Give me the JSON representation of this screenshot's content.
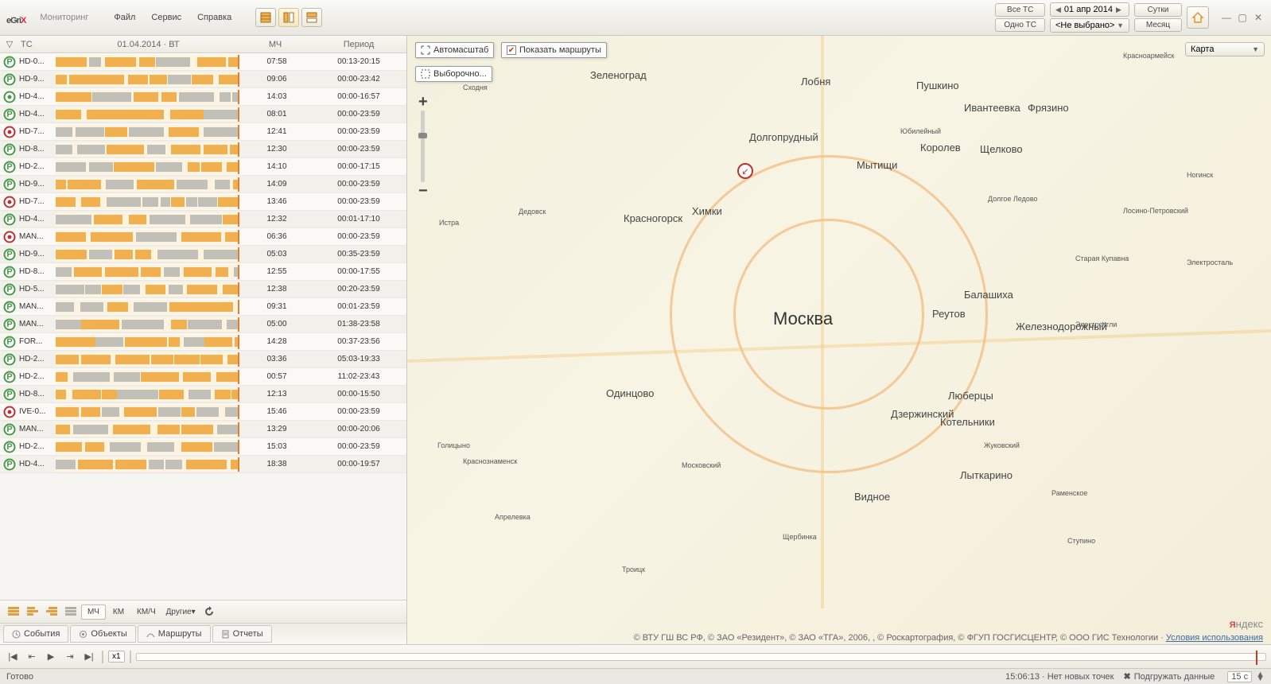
{
  "app": {
    "logo_main": "eGri",
    "logo_x": "X",
    "title": "Мониторинг",
    "menu": {
      "file": "Файл",
      "service": "Сервис",
      "help": "Справка"
    }
  },
  "date_nav": {
    "label": "01 апр 2014"
  },
  "right": {
    "all_ts": "Все ТС",
    "one_ts": "Одно ТС",
    "not_selected": "<Не выбрано>",
    "day": "Сутки",
    "month": "Месяц"
  },
  "columns": {
    "ts": "ТС",
    "date": "01.04.2014 · ВТ",
    "mch": "МЧ",
    "period": "Период"
  },
  "vehicles": [
    {
      "name": "HD-0...",
      "mch": "07:58",
      "period": "00:13-20:15",
      "st": "gp"
    },
    {
      "name": "HD-9...",
      "mch": "09:06",
      "period": "00:00-23:42",
      "st": "gp"
    },
    {
      "name": "HD-4...",
      "mch": "14:03",
      "period": "00:00-16:57",
      "st": "g"
    },
    {
      "name": "HD-4...",
      "mch": "08:01",
      "period": "00:00-23:59",
      "st": "gp"
    },
    {
      "name": "HD-7...",
      "mch": "12:41",
      "period": "00:00-23:59",
      "st": "r"
    },
    {
      "name": "HD-8...",
      "mch": "12:30",
      "period": "00:00-23:59",
      "st": "gp"
    },
    {
      "name": "HD-2...",
      "mch": "14:10",
      "period": "00:00-17:15",
      "st": "gp"
    },
    {
      "name": "HD-9...",
      "mch": "14:09",
      "period": "00:00-23:59",
      "st": "gp"
    },
    {
      "name": "HD-7...",
      "mch": "13:46",
      "period": "00:00-23:59",
      "st": "r"
    },
    {
      "name": "HD-4...",
      "mch": "12:32",
      "period": "00:01-17:10",
      "st": "gp"
    },
    {
      "name": "MAN...",
      "mch": "06:36",
      "period": "00:00-23:59",
      "st": "r"
    },
    {
      "name": "HD-9...",
      "mch": "05:03",
      "period": "00:35-23:59",
      "st": "gp"
    },
    {
      "name": "HD-8...",
      "mch": "12:55",
      "period": "00:00-17:55",
      "st": "gp"
    },
    {
      "name": "HD-5...",
      "mch": "12:38",
      "period": "00:20-23:59",
      "st": "gp"
    },
    {
      "name": "MAN...",
      "mch": "09:31",
      "period": "00:01-23:59",
      "st": "gp"
    },
    {
      "name": "MAN...",
      "mch": "05:00",
      "period": "01:38-23:58",
      "st": "gp"
    },
    {
      "name": "FOR...",
      "mch": "14:28",
      "period": "00:37-23:56",
      "st": "gp"
    },
    {
      "name": "HD-2...",
      "mch": "03:36",
      "period": "05:03-19:33",
      "st": "gp"
    },
    {
      "name": "HD-2...",
      "mch": "00:57",
      "period": "11:02-23:43",
      "st": "gp"
    },
    {
      "name": "HD-8...",
      "mch": "12:13",
      "period": "00:00-15:50",
      "st": "gp"
    },
    {
      "name": "IVE-0...",
      "mch": "15:46",
      "period": "00:00-23:59",
      "st": "r"
    },
    {
      "name": "MAN...",
      "mch": "13:29",
      "period": "00:00-20:06",
      "st": "gp"
    },
    {
      "name": "HD-2...",
      "mch": "15:03",
      "period": "00:00-23:59",
      "st": "gp"
    },
    {
      "name": "HD-4...",
      "mch": "18:38",
      "period": "00:00-19:57",
      "st": "gp"
    }
  ],
  "left_toolbar": {
    "mch": "МЧ",
    "km": "КМ",
    "kmh": "КМ/Ч",
    "other": "Другие▾"
  },
  "left_tabs": {
    "events": "События",
    "objects": "Объекты",
    "routes": "Маршруты",
    "reports": "Отчеты"
  },
  "map": {
    "autoscale": "Автомасштаб",
    "show_routes": "Показать маршруты",
    "selective": "Выборочно...",
    "type_label": "Карта",
    "moscow": "Москва",
    "cities_med": [
      "Зеленоград",
      "Химки",
      "Мытищи",
      "Королев",
      "Щелково",
      "Фрязино",
      "Пушкино",
      "Ивантеевка",
      "Долгопрудный",
      "Лобня",
      "Красногорск",
      "Балашиха",
      "Реутов",
      "Железнодорожный",
      "Одинцово",
      "Люберцы",
      "Дзержинский",
      "Котельники",
      "Лыткарино",
      "Видное",
      "Щербинка",
      "Московский",
      "Голицыно",
      "Краснознаменск",
      "Апрелевка",
      "Троицк",
      "Жуковский",
      "Раменское",
      "Электроугли",
      "Дедовск",
      "Старая Купавна",
      "Лосино-Петровский",
      "Электросталь",
      "Ногинск",
      "Красноармейск",
      "Сходня",
      "Истра",
      "Юбилейный",
      "Долгое Ледово",
      "Ступино"
    ],
    "attribution": "© ВТУ ГШ ВС РФ, © ЗАО «Резидент», © ЗАО «ТГА», 2006, , © Роскартография, © ФГУП ГОСГИСЦЕНТР, © ООО ГИС Технологии · ",
    "terms": "Условия использования",
    "ymaps_1": "Яндекс"
  },
  "timeline": {
    "speed": "x1"
  },
  "status": {
    "ready": "Готово",
    "time": "15:06:13 · Нет новых точек",
    "load": "Подгружать данные",
    "interval": "15 с"
  }
}
